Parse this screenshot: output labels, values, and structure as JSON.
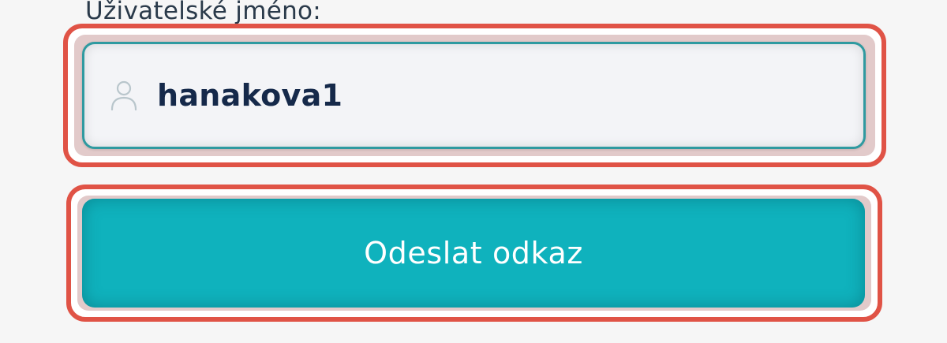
{
  "form": {
    "username_label": "Uživatelské jméno:",
    "username_value": "hanakova1",
    "username_icon": "user-icon",
    "submit_label": "Odeslat odkaz"
  },
  "colors": {
    "accent": "#0fb2bd",
    "input_border": "#2f9aa0",
    "highlight": "#e05346",
    "text_dark": "#15294a"
  }
}
